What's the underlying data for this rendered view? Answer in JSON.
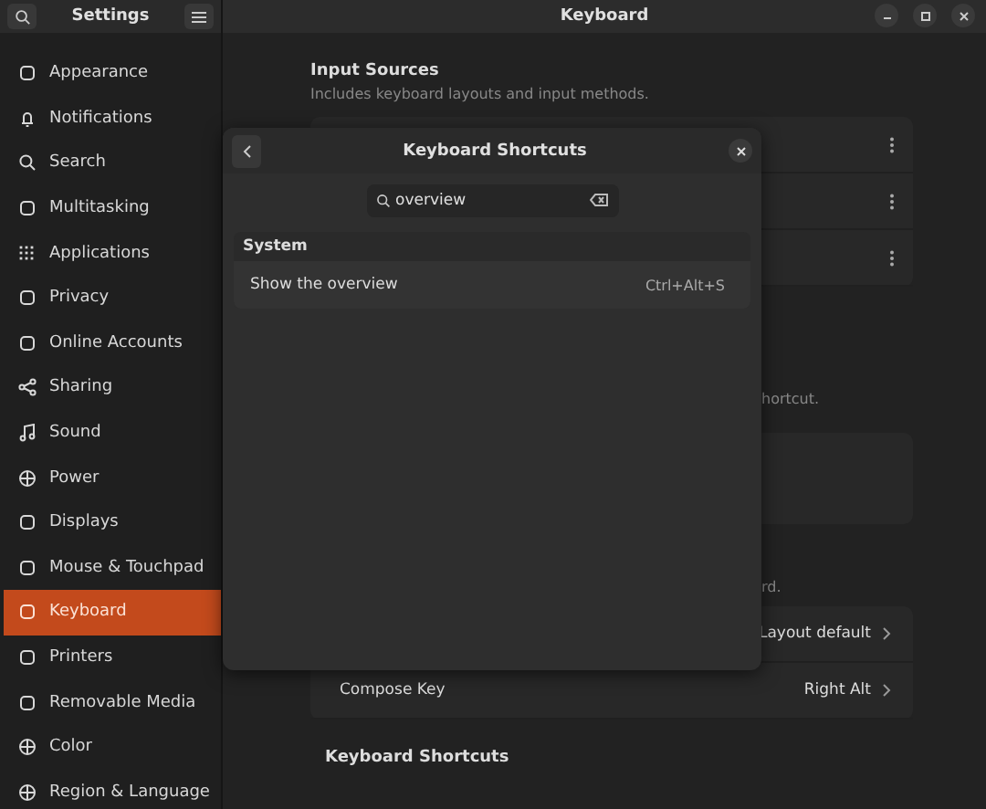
{
  "window": {
    "sidebar_title": "Settings",
    "title": "Keyboard"
  },
  "sidebar": {
    "items": [
      {
        "label": "Appearance",
        "selected": false
      },
      {
        "label": "Notifications",
        "selected": false
      },
      {
        "label": "Search",
        "selected": false
      },
      {
        "label": "Multitasking",
        "selected": false
      },
      {
        "label": "Applications",
        "selected": false
      },
      {
        "label": "Privacy",
        "selected": false
      },
      {
        "label": "Online Accounts",
        "selected": false
      },
      {
        "label": "Sharing",
        "selected": false
      },
      {
        "label": "Sound",
        "selected": false
      },
      {
        "label": "Power",
        "selected": false
      },
      {
        "label": "Displays",
        "selected": false
      },
      {
        "label": "Mouse & Touchpad",
        "selected": false
      },
      {
        "label": "Keyboard",
        "selected": true
      },
      {
        "label": "Printers",
        "selected": false
      },
      {
        "label": "Removable Media",
        "selected": false
      },
      {
        "label": "Color",
        "selected": false
      },
      {
        "label": "Region & Language",
        "selected": false
      }
    ]
  },
  "main": {
    "input_sources": {
      "title": "Input Sources",
      "subtitle": "Includes keyboard layouts and input methods."
    },
    "partial_text_1": "hortcut.",
    "partial_text_2": "rd.",
    "settings_rows": [
      {
        "label": "",
        "value": "Layout default"
      },
      {
        "label": "Compose Key",
        "value": "Right Alt"
      }
    ],
    "section_title": "Keyboard Shortcuts"
  },
  "dialog": {
    "title": "Keyboard Shortcuts",
    "search": {
      "value": "overview"
    },
    "groups": [
      {
        "name": "System",
        "rows": [
          {
            "name": "Show the overview",
            "shortcut": "Ctrl+Alt+S"
          }
        ]
      }
    ]
  }
}
